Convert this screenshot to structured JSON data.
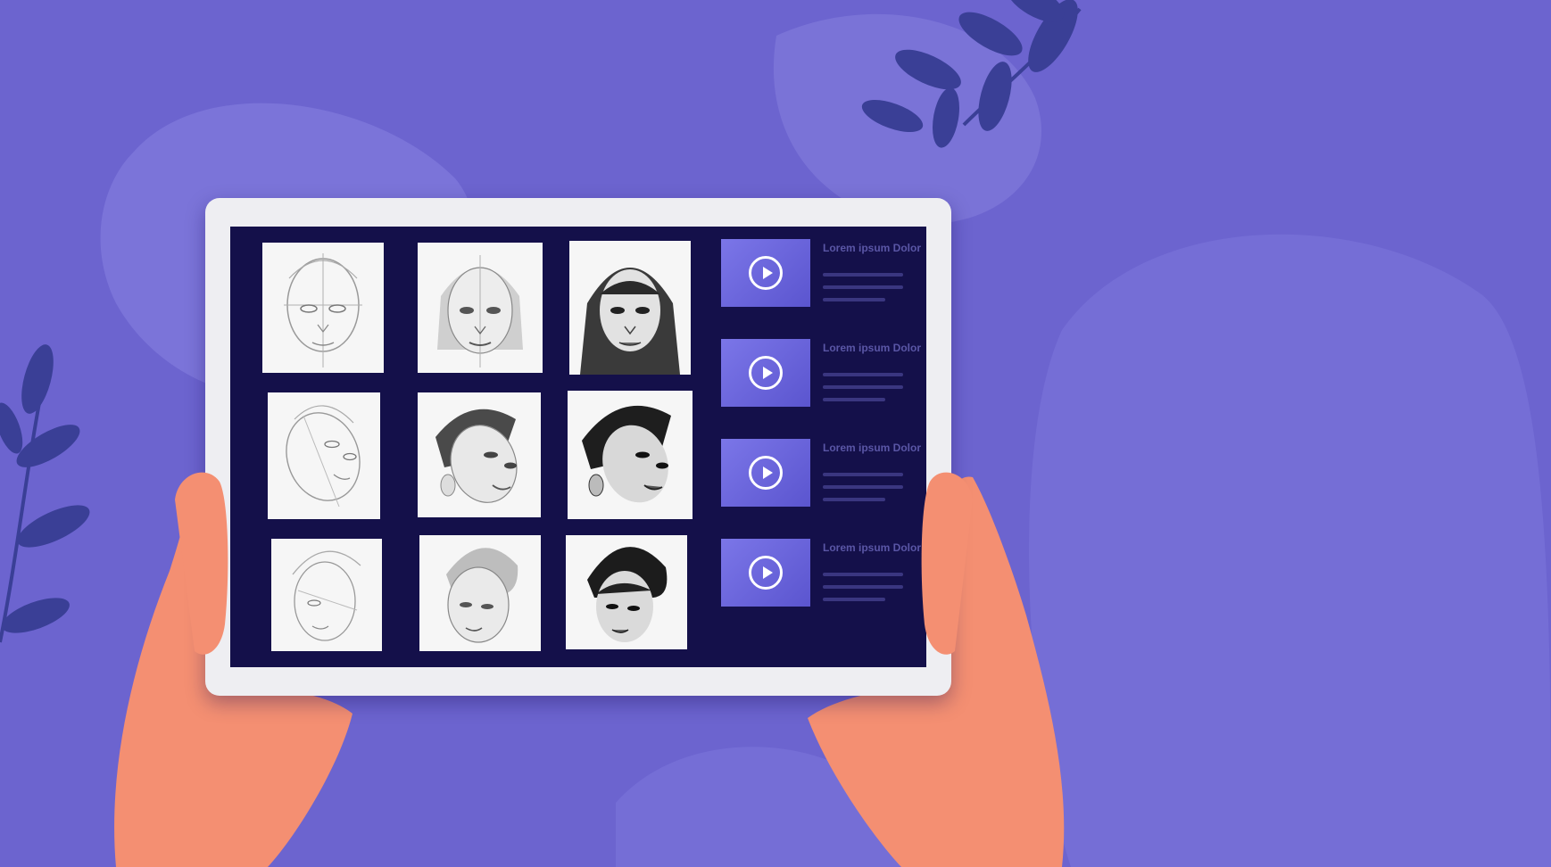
{
  "colors": {
    "background": "#6a63cd",
    "background_blob": "#7a73d8",
    "leaf": "#2e3a8c",
    "tablet_frame": "#eeeef2",
    "screen": "#14104a",
    "video_thumb": "#6a65dd",
    "hand": "#f48f72"
  },
  "sketches": [
    {
      "name": "face-front-outline",
      "stage": "outline"
    },
    {
      "name": "face-front-shaded",
      "stage": "shaded"
    },
    {
      "name": "face-front-finished",
      "stage": "finished"
    },
    {
      "name": "face-tilt-outline",
      "stage": "outline"
    },
    {
      "name": "face-tilt-shaded",
      "stage": "shaded"
    },
    {
      "name": "face-tilt-finished",
      "stage": "finished"
    },
    {
      "name": "face-side-outline",
      "stage": "outline"
    },
    {
      "name": "face-side-shaded",
      "stage": "shaded"
    },
    {
      "name": "face-side-finished",
      "stage": "finished"
    }
  ],
  "videos": [
    {
      "title": "Lorem ipsum Dolor",
      "icon": "play-icon"
    },
    {
      "title": "Lorem ipsum Dolor",
      "icon": "play-icon"
    },
    {
      "title": "Lorem ipsum Dolor",
      "icon": "play-icon"
    },
    {
      "title": "Lorem ipsum Dolor",
      "icon": "play-icon"
    }
  ]
}
